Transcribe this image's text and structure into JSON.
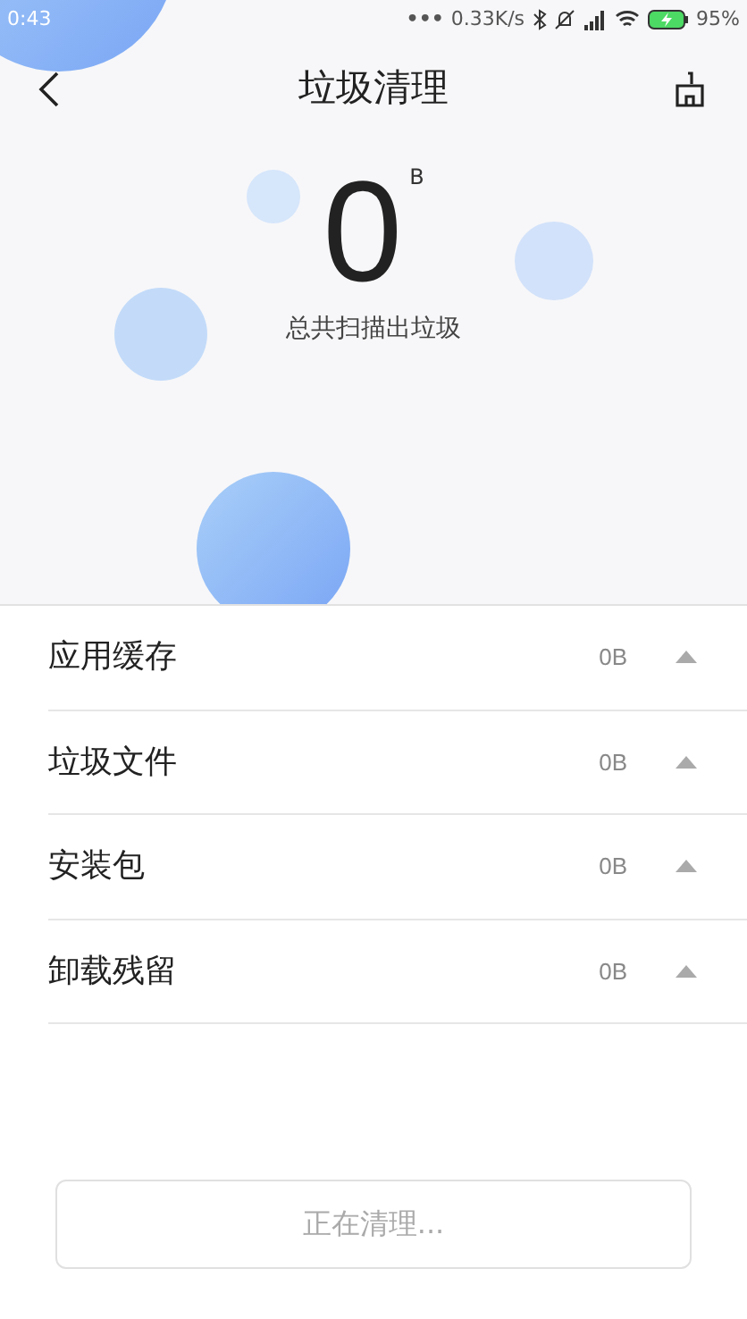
{
  "status_bar": {
    "time": "0:43",
    "dots": "•••",
    "speed": "0.33K/s",
    "battery": "95%"
  },
  "header": {
    "title": "垃圾清理"
  },
  "summary": {
    "amount": "0",
    "unit": "B",
    "caption": "总共扫描出垃圾"
  },
  "categories": [
    {
      "label": "应用缓存",
      "size": "0B"
    },
    {
      "label": "垃圾文件",
      "size": "0B"
    },
    {
      "label": "安装包",
      "size": "0B"
    },
    {
      "label": "卸载残留",
      "size": "0B"
    }
  ],
  "action_button": {
    "label": "正在清理...",
    "disabled": true
  }
}
